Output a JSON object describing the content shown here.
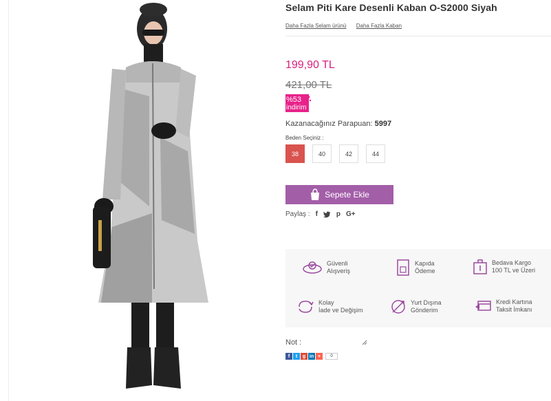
{
  "product": {
    "title": "Selam Piti Kare Desenli Kaban O-S2000 Siyah",
    "links": [
      "Daha Fazla Selam ürünü",
      "Daha Fazla Kaban"
    ],
    "price": "199,90 TL",
    "old_price": "421,00 TL",
    "discount_pct": "%53",
    "discount_word": "indirim",
    "parapuan_label": "Kazanacağınız Parapuan:",
    "parapuan_value": "5997",
    "size_label": "Beden Seçiniz :",
    "sizes": [
      "38",
      "40",
      "42",
      "44"
    ],
    "selected_size": "38",
    "add_to_cart": "Sepete Ekle",
    "share_label": "Paylaş :",
    "share_icons": [
      "f",
      "t",
      "p",
      "G+"
    ]
  },
  "features": {
    "secure_1": "Güvenli",
    "secure_2": "Alışveriş",
    "door_1": "Kapıda",
    "door_2": "Ödeme",
    "cargo_1": "Bedava Kargo",
    "cargo_2": "100 TL  ve Üzeri",
    "return_1": "Kolay",
    "return_2": "İade ve Değişim",
    "abroad_1": "Yurt Dışına",
    "abroad_2": "Gönderim",
    "credit_1": "Kredi Kartına",
    "credit_2": "Taksit İmkanı"
  },
  "note_label": "Not :",
  "social_count": "0",
  "colors": {
    "price": "#d6217e",
    "discount": "#e8228a",
    "cart_button": "#a35ea8",
    "selected_size": "#d9534f",
    "feature_icon": "#9b4a9e"
  }
}
